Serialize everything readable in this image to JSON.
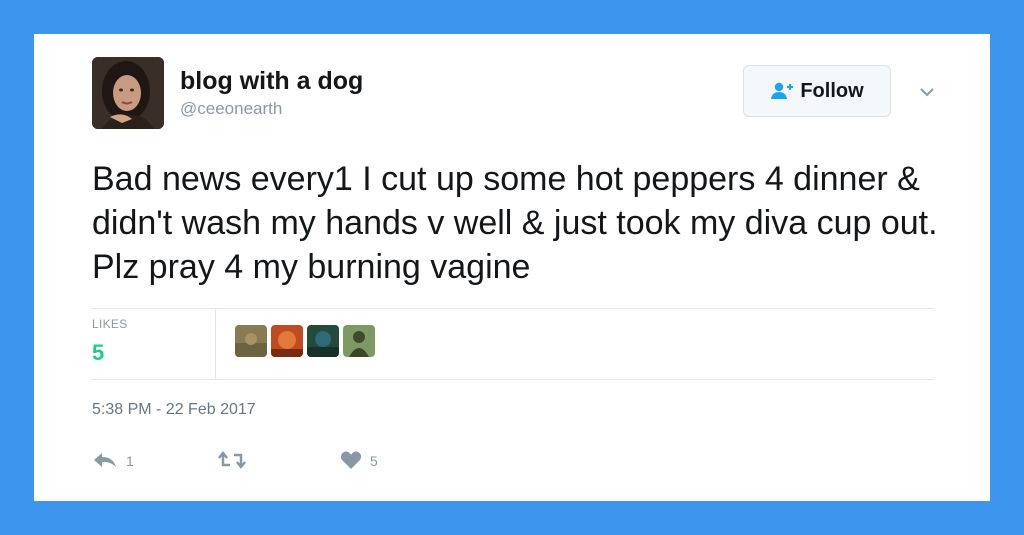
{
  "tweet": {
    "display_name": "blog with a dog",
    "handle": "@ceeonearth",
    "follow_label": "Follow",
    "text": "Bad news every1 I cut up some hot peppers 4 dinner & didn't wash my hands v well & just took my diva cup out. Plz pray 4 my burning vagine",
    "likes_label": "LIKES",
    "likes_count": "5",
    "timestamp": "5:38 PM - 22 Feb 2017",
    "actions": {
      "reply_icon": "reply-icon",
      "reply_count": "1",
      "retweet_icon": "retweet-icon",
      "retweet_count": "",
      "like_icon": "heart-icon",
      "like_count": "5"
    }
  },
  "colors": {
    "background": "#3d95ee",
    "card": "#ffffff",
    "accent": "#1da1f2",
    "likes_green": "#19cf86",
    "muted": "#8899a6"
  }
}
